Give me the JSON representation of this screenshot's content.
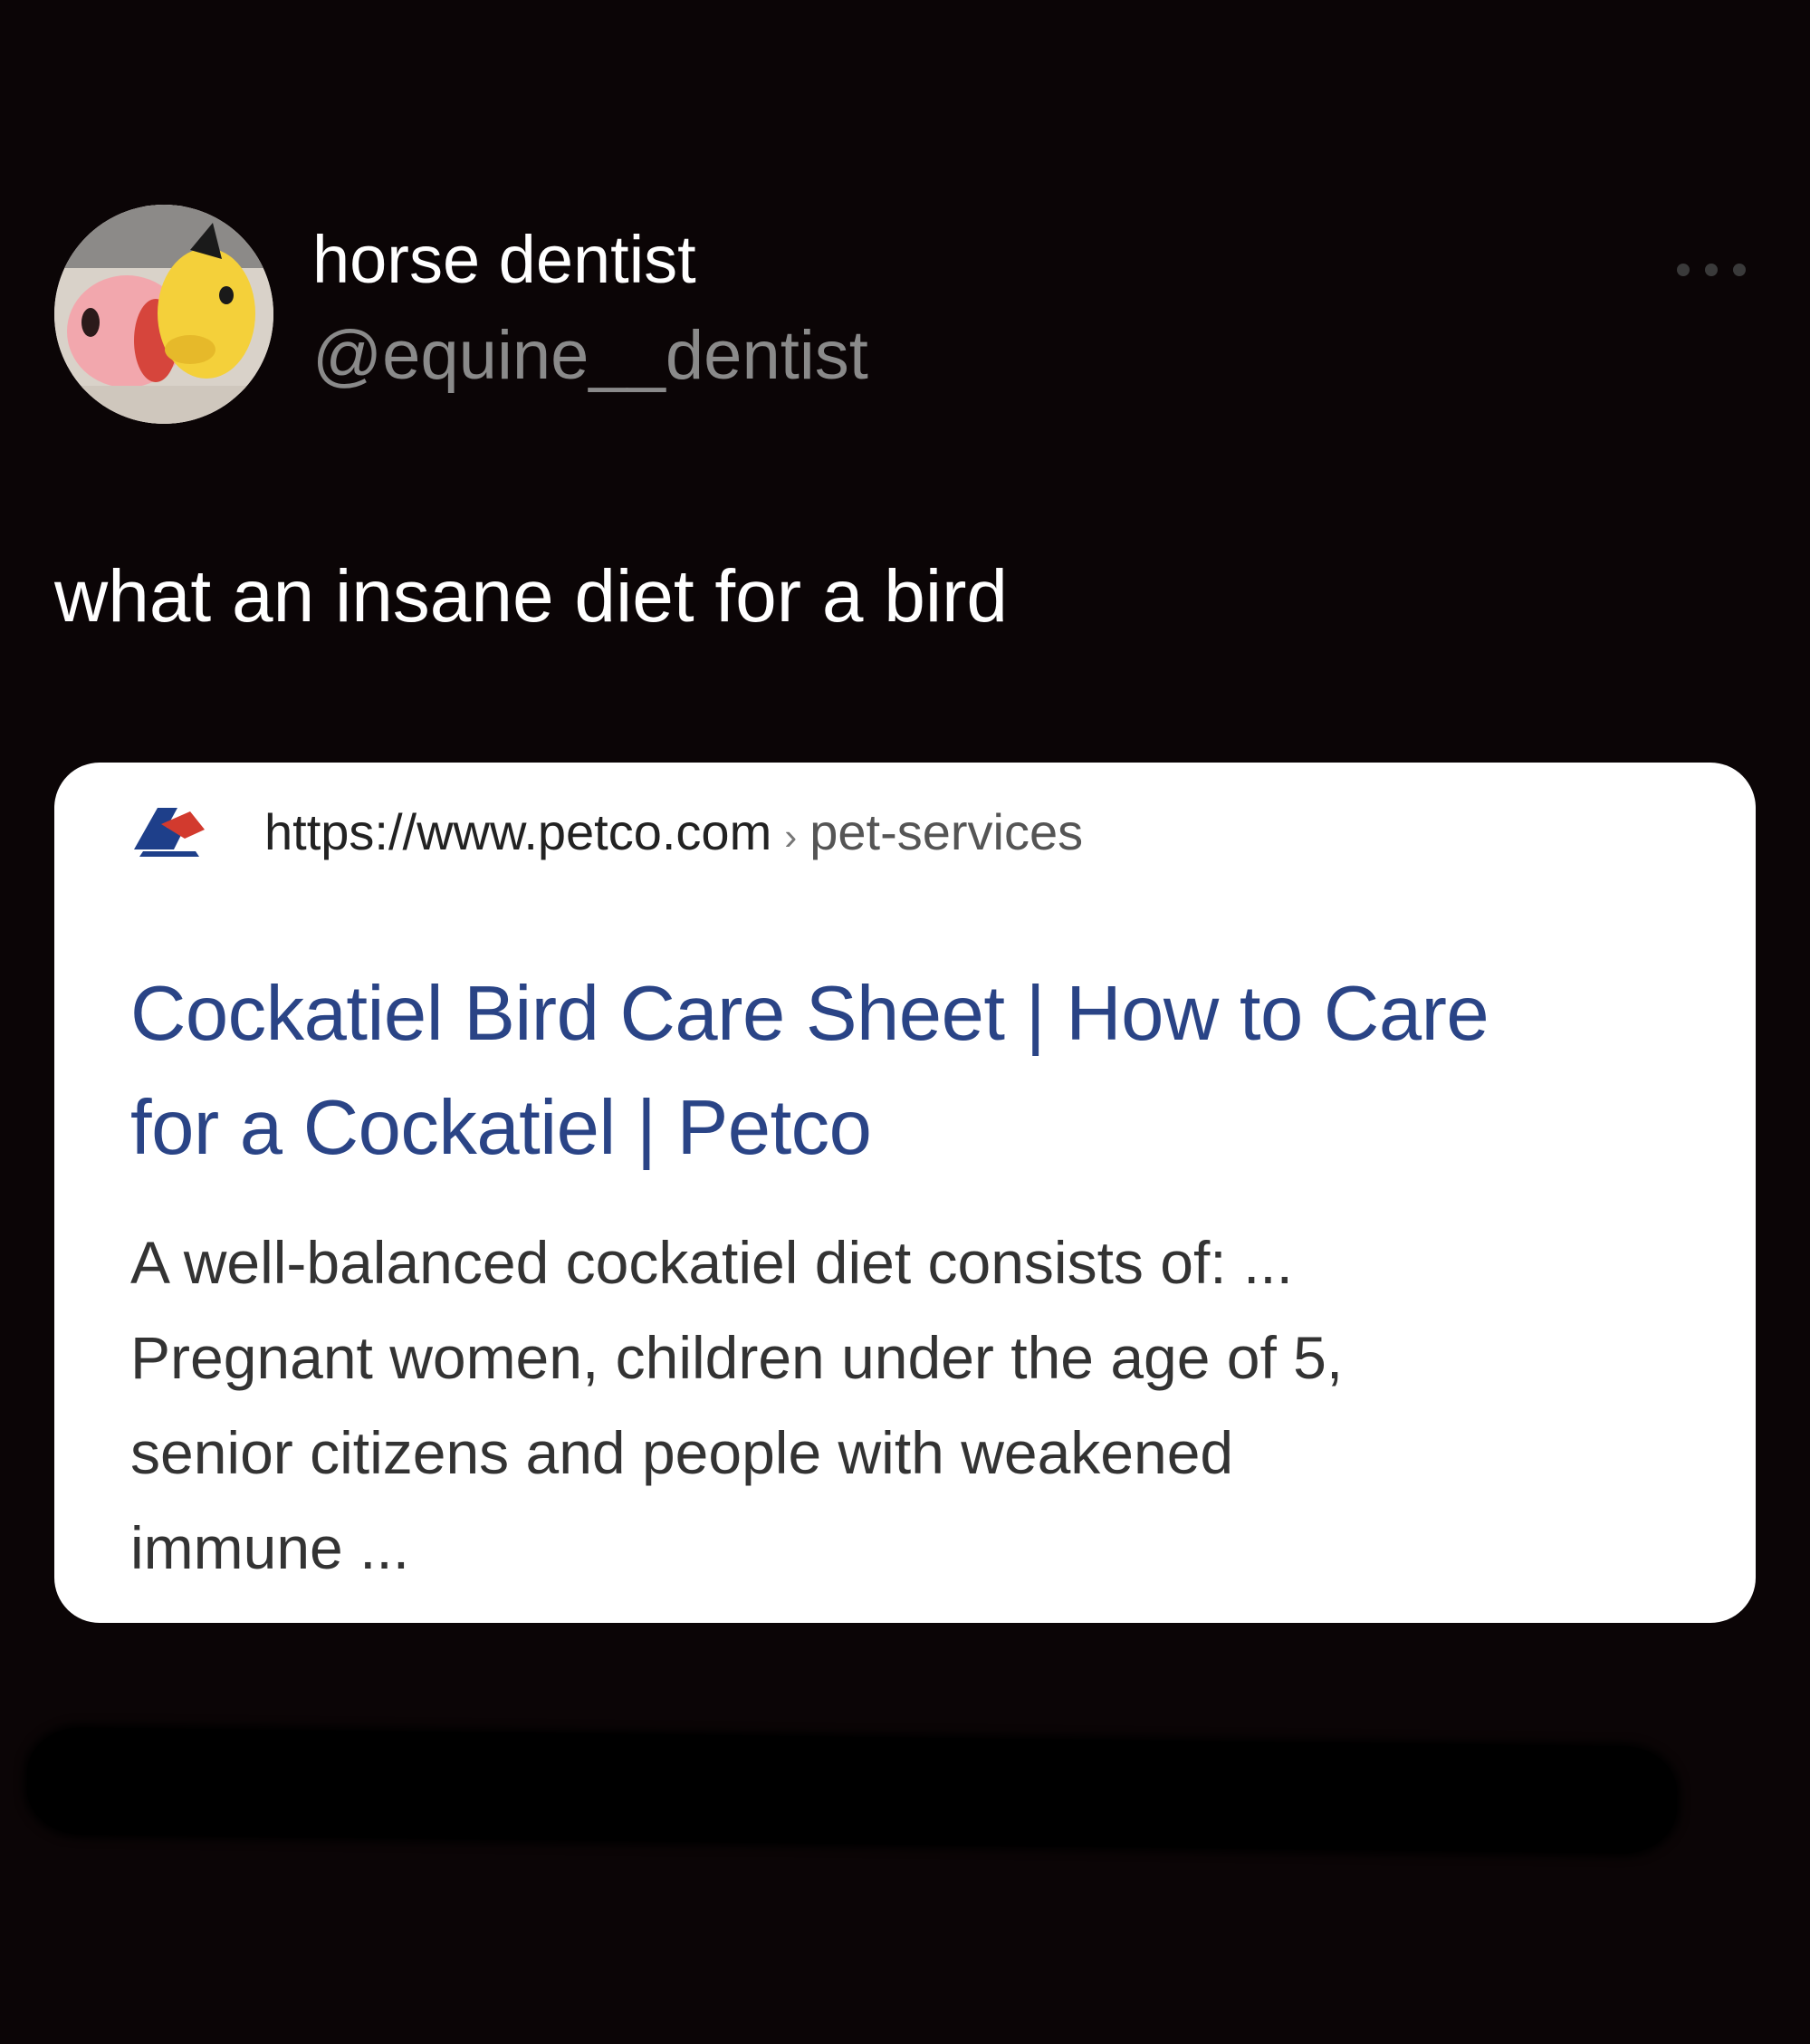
{
  "post": {
    "author": {
      "display_name": "horse dentist",
      "handle": "@equine__dentist",
      "avatar_icon": "cartoon-characters-avatar"
    },
    "more_icon": "more-dots-icon",
    "text": "what an insane diet for a bird"
  },
  "card": {
    "favicon_icon": "petco-logo-icon",
    "url": "https://www.petco.com",
    "url_separator": "›",
    "url_path": "pet-services",
    "title_line1": "Cockatiel Bird Care Sheet | How to Care",
    "title_line2": "for a Cockatiel | Petco",
    "snippet_lines": [
      "A well-balanced cockatiel diet consists of: ...",
      "Pregnant women, children under the age of 5,",
      "senior citizens and people with weakened",
      "immune ..."
    ]
  },
  "colors": {
    "background": "#0b0506",
    "title_link": "#2a4486",
    "handle": "#8a8a8a"
  }
}
